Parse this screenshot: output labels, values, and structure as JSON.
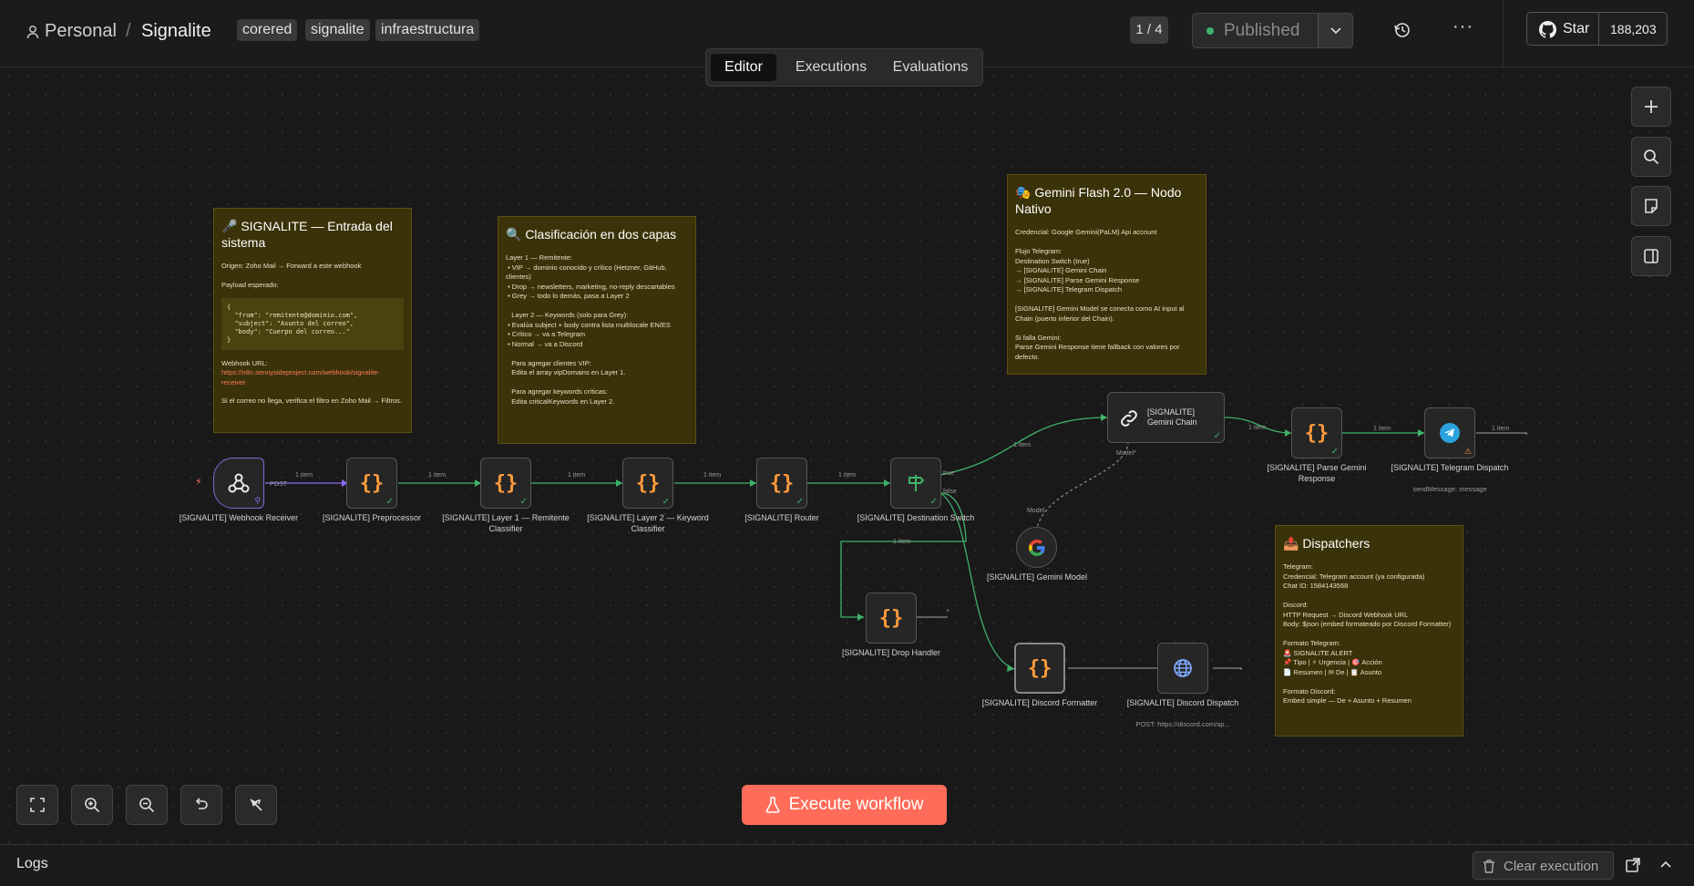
{
  "header": {
    "breadcrumb_project": "Personal",
    "breadcrumb_sep": "/",
    "workflow_name": "Signalite",
    "tags": [
      "corered",
      "signalite",
      "infraestructura"
    ],
    "version_badge": "1 / 4",
    "publish_label": "Published",
    "more_label": "···",
    "github_star_label": "Star",
    "github_star_count": "188,203"
  },
  "tabs": [
    "Editor",
    "Executions",
    "Evaluations"
  ],
  "stickies": {
    "entrada": {
      "title": "🎤 SIGNALITE — Entrada del sistema",
      "pre": "Origen: Zoho Mail → Forward a este webhook\n\nPayload esperado:",
      "code": "{\n  \"from\": \"remitente@dominio.com\",\n  \"subject\": \"Asunto del correo\",\n  \"body\": \"Cuerpo del correo...\"\n}",
      "webhook_label": "Webhook URL:",
      "webhook_url": "https://n8n.sennysideproject.com/webhook/signalite-receiver",
      "post": "Si el correo no llega, verifica el filtro en Zoho Mail → Filtros."
    },
    "clasificacion": {
      "title": "🔍 Clasificación en dos capas",
      "body": "Layer 1 — Remitente:\n • VIP → dominio conocido y crítico (Hetzner, GitHub, clientes)\n • Drop → newsletters, marketing, no-reply descartables\n • Grey → todo lo demás, pasa a Layer 2\n\n   Layer 2 — Keywords (solo para Grey):\n • Evalúa subject + body contra lista multilocale EN/ES\n • Crítico → va a Telegram\n • Normal → va a Discord\n\n   Para agregar clientes VIP:\n   Edita el array vipDomains en Layer 1.\n\n   Para agregar keywords críticas:\n   Edita criticalKeywords en Layer 2."
    },
    "gemini": {
      "title": "🎭 Gemini Flash 2.0 — Nodo Nativo",
      "body": "Credencial: Google Gemini(PaLM) Api account\n\nFlujo Telegram:\nDestination Switch (true)\n→ [SIGNALITE] Gemini Chain\n→ [SIGNALITE] Parse Gemini Response\n→ [SIGNALITE] Telegram Dispatch\n\n[SIGNALITE] Gemini Model se conecta como AI input al Chain (puerto inferior del Chain).\n\nSi falla Gemini:\nParse Gemini Response tiene fallback con valores por defecto."
    },
    "dispatchers": {
      "title": "📤 Dispatchers",
      "body": "Telegram:\nCredencial: Telegram account (ya configurada)\nChat ID: 1584143568\n\nDiscord:\nHTTP Request → Discord Webhook URL\nBody: $json (embed formateado por Discord Formatter)\n\nFormato Telegram:\n🚨 SIGNALITE ALERT\n📌 Tipo | ⚡ Urgencia | 🎯 Acción\n📄 Resumen | ✉ De | 📋 Asunto\n\nFormato Discord:\nEmbed simple — De + Asunto + Resumen"
    }
  },
  "nodes": {
    "webhook": {
      "label": "[SIGNALITE] Webhook Receiver",
      "icon": "webhook-icon"
    },
    "preprocessor": {
      "label": "[SIGNALITE] Preprocessor",
      "icon": "code-braces-icon"
    },
    "layer1": {
      "label": "[SIGNALITE] Layer 1 — Remitente Classifier",
      "icon": "code-braces-icon"
    },
    "layer2": {
      "label": "[SIGNALITE] Layer 2 — Keyword Classifier",
      "icon": "code-braces-icon"
    },
    "router": {
      "label": "[SIGNALITE] Router",
      "icon": "code-braces-icon"
    },
    "switch": {
      "label": "[SIGNALITE] Destination Switch",
      "icon": "signpost-icon"
    },
    "chain": {
      "label": "[SIGNALITE] Gemini Chain",
      "icon": "link-icon"
    },
    "parse": {
      "label": "[SIGNALITE] Parse Gemini Response",
      "icon": "code-braces-icon"
    },
    "telegram": {
      "label": "[SIGNALITE] Telegram Dispatch",
      "sub": "sendMessage: message",
      "icon": "telegram-icon"
    },
    "geminiModel": {
      "label": "[SIGNALITE] Gemini Model",
      "icon": "google-icon"
    },
    "drop": {
      "label": "[SIGNALITE] Drop Handler",
      "icon": "code-braces-icon"
    },
    "discordFmt": {
      "label": "[SIGNALITE] Discord Formatter",
      "icon": "code-braces-icon"
    },
    "discordDispatch": {
      "label": "[SIGNALITE] Discord Dispatch",
      "sub": "POST: https://discord.com/ap...",
      "icon": "globe-icon"
    }
  },
  "edges": {
    "item": "1 item",
    "post": "POST",
    "true": "true",
    "false": "false",
    "model_out": "Model*",
    "model_in": "Model"
  },
  "brace_glyph": "{}",
  "execute_label": "Execute workflow",
  "logs_label": "Logs",
  "clear_label": "Clear execution",
  "colors": {
    "accent": "#ff6d5a",
    "edge": "#3fb36b",
    "sticky": "#3a3208",
    "brace": "#ff9a3c"
  }
}
